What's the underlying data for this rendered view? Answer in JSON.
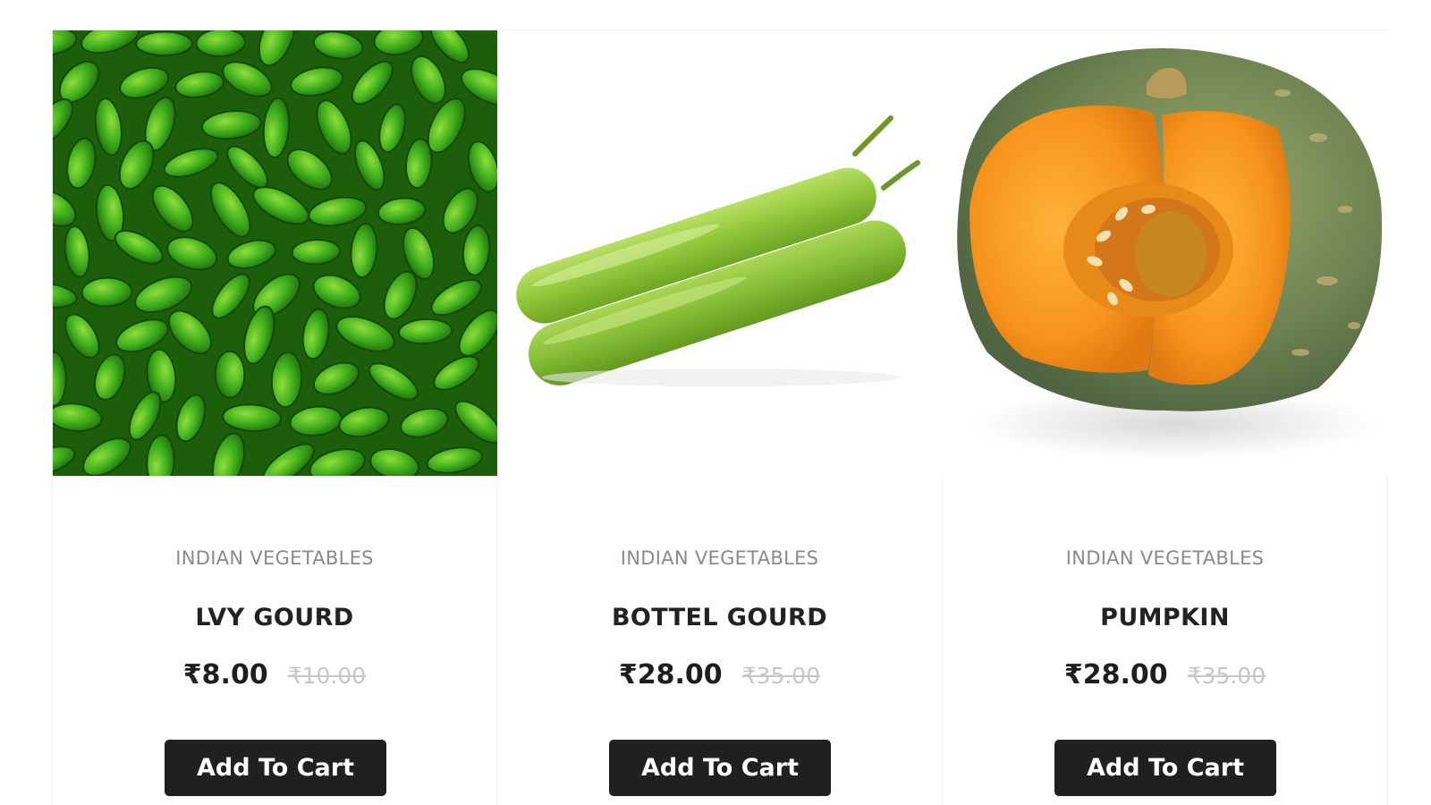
{
  "products": [
    {
      "image": "ivy-gourd-image",
      "category": "INDIAN VEGETABLES",
      "name": "LVY GOURD",
      "price": "₹8.00",
      "old_price": "₹10.00",
      "button_label": "Add To Cart"
    },
    {
      "image": "bottle-gourd-image",
      "category": "INDIAN VEGETABLES",
      "name": "BOTTEL GOURD",
      "price": "₹28.00",
      "old_price": "₹35.00",
      "button_label": "Add To Cart"
    },
    {
      "image": "pumpkin-image",
      "category": "INDIAN VEGETABLES",
      "name": "PUMPKIN",
      "price": "₹28.00",
      "old_price": "₹35.00",
      "button_label": "Add To Cart"
    }
  ],
  "colors": {
    "button_bg": "#202020",
    "button_text": "#ffffff",
    "category_text": "#8a8a8a",
    "old_price_text": "#c6c6c6"
  }
}
